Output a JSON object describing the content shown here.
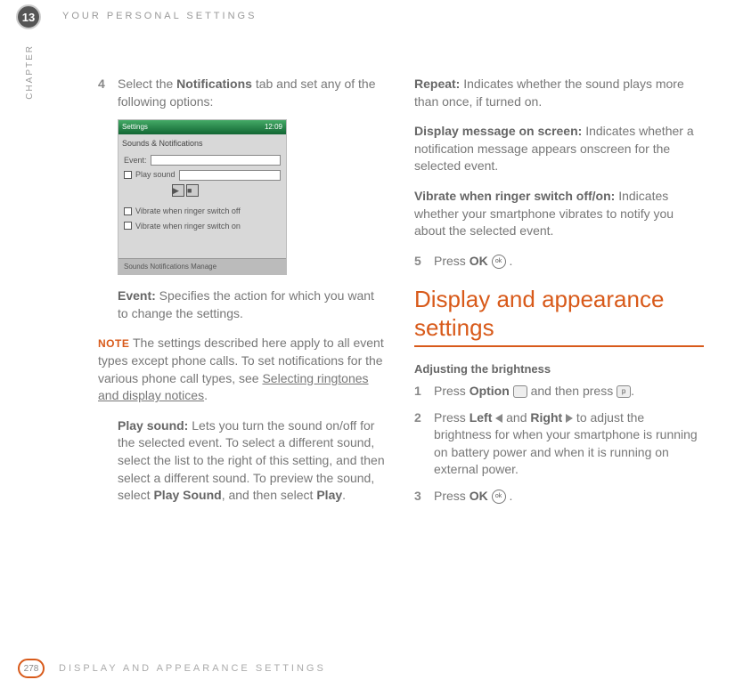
{
  "chapter": {
    "number": "13",
    "label": "CHAPTER",
    "title": "YOUR PERSONAL SETTINGS"
  },
  "left": {
    "step4": {
      "num": "4",
      "pre": "Select the ",
      "bold": "Notifications",
      "post": " tab and set any of the following options:"
    },
    "screenshot": {
      "title_left": "Settings",
      "title_right": "12:09",
      "subtitle": "Sounds & Notifications",
      "event_label": "Event:",
      "play_label": "Play sound",
      "vib_off": "Vibrate when ringer switch off",
      "vib_on": "Vibrate when ringer switch on",
      "tabs": "Sounds  Notifications  Manage"
    },
    "event": {
      "bold": "Event:",
      "text": " Specifies the action for which you want to change the settings."
    },
    "note": {
      "label": "NOTE",
      "text": "The settings described here apply to all event types except phone calls. To set notifications for the various phone call types, see ",
      "link": "Selecting ringtones and display notices",
      "post": "."
    },
    "play": {
      "bold": "Play sound:",
      "text": " Lets you turn the sound on/off for the selected event. To select a different sound, select the list to the right of this setting, and then select a different sound. To preview the sound, select ",
      "bold2": "Play Sound",
      "mid": ", and then select ",
      "bold3": "Play",
      "post2": "."
    }
  },
  "right": {
    "repeat": {
      "bold": "Repeat:",
      "text": " Indicates whether the sound plays more than once, if turned on."
    },
    "display_msg": {
      "bold": "Display message on screen:",
      "text": " Indicates whether a notification message appears onscreen for the selected event."
    },
    "vibrate": {
      "bold": "Vibrate when ringer switch off/on:",
      "text": " Indicates whether your smartphone vibrates to notify you about the selected event."
    },
    "step5": {
      "num": "5",
      "pre": "Press ",
      "bold": "OK",
      "post": " ."
    },
    "section_title": "Display and appearance settings",
    "subhead": "Adjusting the brightness",
    "b1": {
      "num": "1",
      "pre": "Press ",
      "bold": "Option",
      "mid": " and then press ",
      "post": "."
    },
    "b2": {
      "num": "2",
      "pre": "Press ",
      "bold1": "Left",
      "mid1": " and ",
      "bold2": "Right",
      "mid2": " to adjust the brightness for when your smartphone is running on battery power and when it is running on external power."
    },
    "b3": {
      "num": "3",
      "pre": "Press ",
      "bold": "OK",
      "post": " ."
    }
  },
  "footer": {
    "page": "278",
    "title": "DISPLAY AND APPEARANCE SETTINGS"
  }
}
